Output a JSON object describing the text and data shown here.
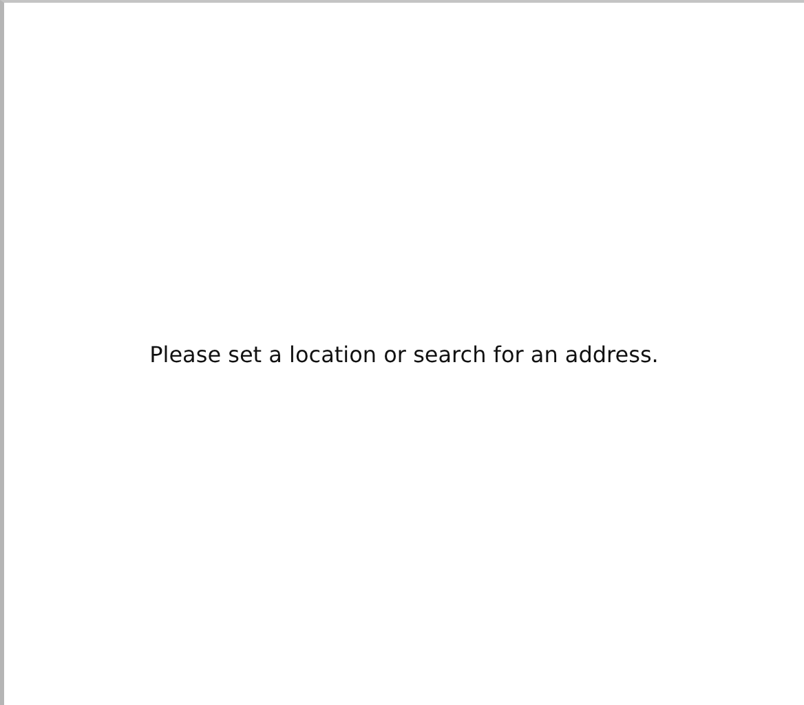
{
  "message": "Please set a location or search for an address."
}
